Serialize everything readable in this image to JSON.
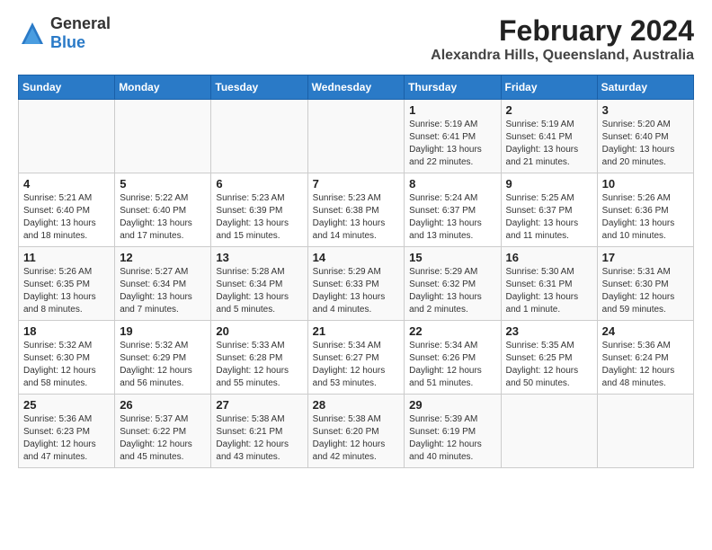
{
  "header": {
    "logo_general": "General",
    "logo_blue": "Blue",
    "title": "February 2024",
    "subtitle": "Alexandra Hills, Queensland, Australia"
  },
  "days_of_week": [
    "Sunday",
    "Monday",
    "Tuesday",
    "Wednesday",
    "Thursday",
    "Friday",
    "Saturday"
  ],
  "weeks": [
    [
      {
        "day": "",
        "info": ""
      },
      {
        "day": "",
        "info": ""
      },
      {
        "day": "",
        "info": ""
      },
      {
        "day": "",
        "info": ""
      },
      {
        "day": "1",
        "info": "Sunrise: 5:19 AM\nSunset: 6:41 PM\nDaylight: 13 hours\nand 22 minutes."
      },
      {
        "day": "2",
        "info": "Sunrise: 5:19 AM\nSunset: 6:41 PM\nDaylight: 13 hours\nand 21 minutes."
      },
      {
        "day": "3",
        "info": "Sunrise: 5:20 AM\nSunset: 6:40 PM\nDaylight: 13 hours\nand 20 minutes."
      }
    ],
    [
      {
        "day": "4",
        "info": "Sunrise: 5:21 AM\nSunset: 6:40 PM\nDaylight: 13 hours\nand 18 minutes."
      },
      {
        "day": "5",
        "info": "Sunrise: 5:22 AM\nSunset: 6:40 PM\nDaylight: 13 hours\nand 17 minutes."
      },
      {
        "day": "6",
        "info": "Sunrise: 5:23 AM\nSunset: 6:39 PM\nDaylight: 13 hours\nand 15 minutes."
      },
      {
        "day": "7",
        "info": "Sunrise: 5:23 AM\nSunset: 6:38 PM\nDaylight: 13 hours\nand 14 minutes."
      },
      {
        "day": "8",
        "info": "Sunrise: 5:24 AM\nSunset: 6:37 PM\nDaylight: 13 hours\nand 13 minutes."
      },
      {
        "day": "9",
        "info": "Sunrise: 5:25 AM\nSunset: 6:37 PM\nDaylight: 13 hours\nand 11 minutes."
      },
      {
        "day": "10",
        "info": "Sunrise: 5:26 AM\nSunset: 6:36 PM\nDaylight: 13 hours\nand 10 minutes."
      }
    ],
    [
      {
        "day": "11",
        "info": "Sunrise: 5:26 AM\nSunset: 6:35 PM\nDaylight: 13 hours\nand 8 minutes."
      },
      {
        "day": "12",
        "info": "Sunrise: 5:27 AM\nSunset: 6:34 PM\nDaylight: 13 hours\nand 7 minutes."
      },
      {
        "day": "13",
        "info": "Sunrise: 5:28 AM\nSunset: 6:34 PM\nDaylight: 13 hours\nand 5 minutes."
      },
      {
        "day": "14",
        "info": "Sunrise: 5:29 AM\nSunset: 6:33 PM\nDaylight: 13 hours\nand 4 minutes."
      },
      {
        "day": "15",
        "info": "Sunrise: 5:29 AM\nSunset: 6:32 PM\nDaylight: 13 hours\nand 2 minutes."
      },
      {
        "day": "16",
        "info": "Sunrise: 5:30 AM\nSunset: 6:31 PM\nDaylight: 13 hours\nand 1 minute."
      },
      {
        "day": "17",
        "info": "Sunrise: 5:31 AM\nSunset: 6:30 PM\nDaylight: 12 hours\nand 59 minutes."
      }
    ],
    [
      {
        "day": "18",
        "info": "Sunrise: 5:32 AM\nSunset: 6:30 PM\nDaylight: 12 hours\nand 58 minutes."
      },
      {
        "day": "19",
        "info": "Sunrise: 5:32 AM\nSunset: 6:29 PM\nDaylight: 12 hours\nand 56 minutes."
      },
      {
        "day": "20",
        "info": "Sunrise: 5:33 AM\nSunset: 6:28 PM\nDaylight: 12 hours\nand 55 minutes."
      },
      {
        "day": "21",
        "info": "Sunrise: 5:34 AM\nSunset: 6:27 PM\nDaylight: 12 hours\nand 53 minutes."
      },
      {
        "day": "22",
        "info": "Sunrise: 5:34 AM\nSunset: 6:26 PM\nDaylight: 12 hours\nand 51 minutes."
      },
      {
        "day": "23",
        "info": "Sunrise: 5:35 AM\nSunset: 6:25 PM\nDaylight: 12 hours\nand 50 minutes."
      },
      {
        "day": "24",
        "info": "Sunrise: 5:36 AM\nSunset: 6:24 PM\nDaylight: 12 hours\nand 48 minutes."
      }
    ],
    [
      {
        "day": "25",
        "info": "Sunrise: 5:36 AM\nSunset: 6:23 PM\nDaylight: 12 hours\nand 47 minutes."
      },
      {
        "day": "26",
        "info": "Sunrise: 5:37 AM\nSunset: 6:22 PM\nDaylight: 12 hours\nand 45 minutes."
      },
      {
        "day": "27",
        "info": "Sunrise: 5:38 AM\nSunset: 6:21 PM\nDaylight: 12 hours\nand 43 minutes."
      },
      {
        "day": "28",
        "info": "Sunrise: 5:38 AM\nSunset: 6:20 PM\nDaylight: 12 hours\nand 42 minutes."
      },
      {
        "day": "29",
        "info": "Sunrise: 5:39 AM\nSunset: 6:19 PM\nDaylight: 12 hours\nand 40 minutes."
      },
      {
        "day": "",
        "info": ""
      },
      {
        "day": "",
        "info": ""
      }
    ]
  ]
}
